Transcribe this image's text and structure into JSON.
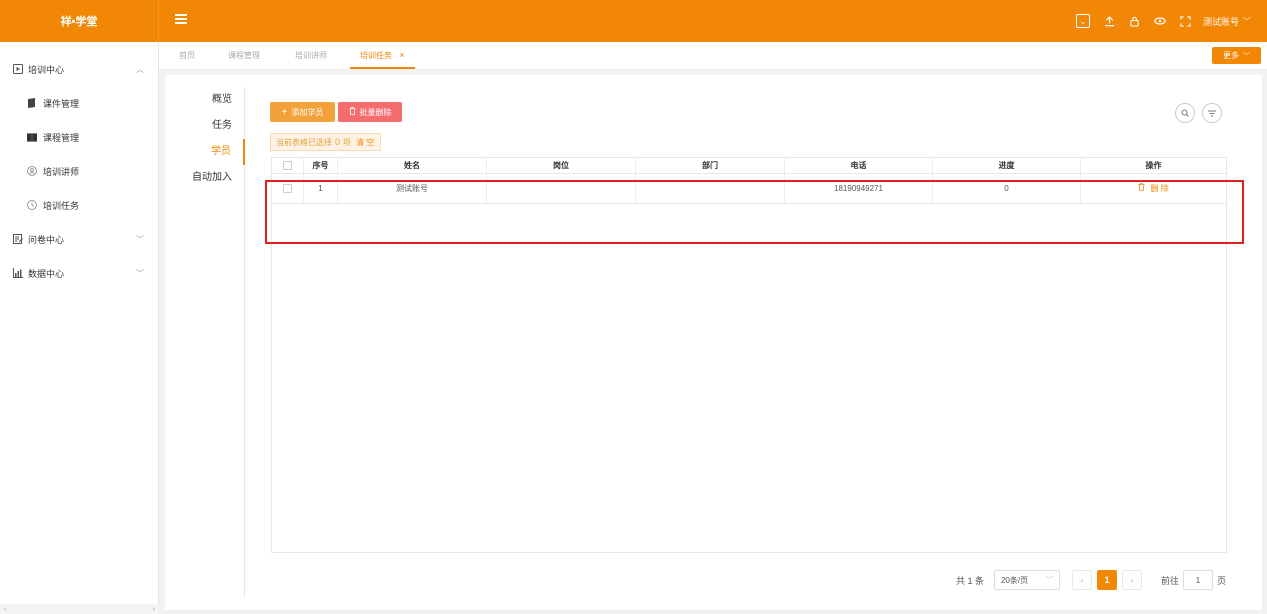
{
  "app": {
    "logo": "祥•学堂",
    "user_name": "测试账号"
  },
  "sidebar": {
    "groups": [
      {
        "label": "培训中心",
        "items": [
          {
            "label": "课件管理"
          },
          {
            "label": "课程管理"
          },
          {
            "label": "培训讲师"
          },
          {
            "label": "培训任务"
          }
        ]
      },
      {
        "label": "问卷中心"
      },
      {
        "label": "数据中心"
      }
    ]
  },
  "tabs": {
    "items": [
      {
        "label": "首页"
      },
      {
        "label": "课程管理"
      },
      {
        "label": "培训讲师"
      },
      {
        "label": "培训任务"
      }
    ],
    "more_label": "更多",
    "active_close": "×"
  },
  "subnav": {
    "items": [
      {
        "label": "概览"
      },
      {
        "label": "任务"
      },
      {
        "label": "学员"
      },
      {
        "label": "自动加入"
      }
    ]
  },
  "toolbar": {
    "add_label": "添加学员",
    "delete_label": "批量删除"
  },
  "selection": {
    "prefix": "当前表格已选择",
    "count": "0",
    "suffix": "项",
    "clear_label": "清 空"
  },
  "table": {
    "columns": [
      "序号",
      "姓名",
      "岗位",
      "部门",
      "电话",
      "进度",
      "操作"
    ],
    "rows": [
      {
        "index": "1",
        "name": "测试账号",
        "post": "",
        "dept": "",
        "phone": "18190949271",
        "progress": "0",
        "op": "删 除"
      }
    ]
  },
  "pagination": {
    "total": "共 1 条",
    "page_size": "20条/页",
    "current": "1",
    "goto_label": "前往",
    "goto_value": "1",
    "page_unit": "页"
  },
  "colors": {
    "brand": "#f28705",
    "danger": "#f56c6c",
    "highlight": "#e02020"
  }
}
